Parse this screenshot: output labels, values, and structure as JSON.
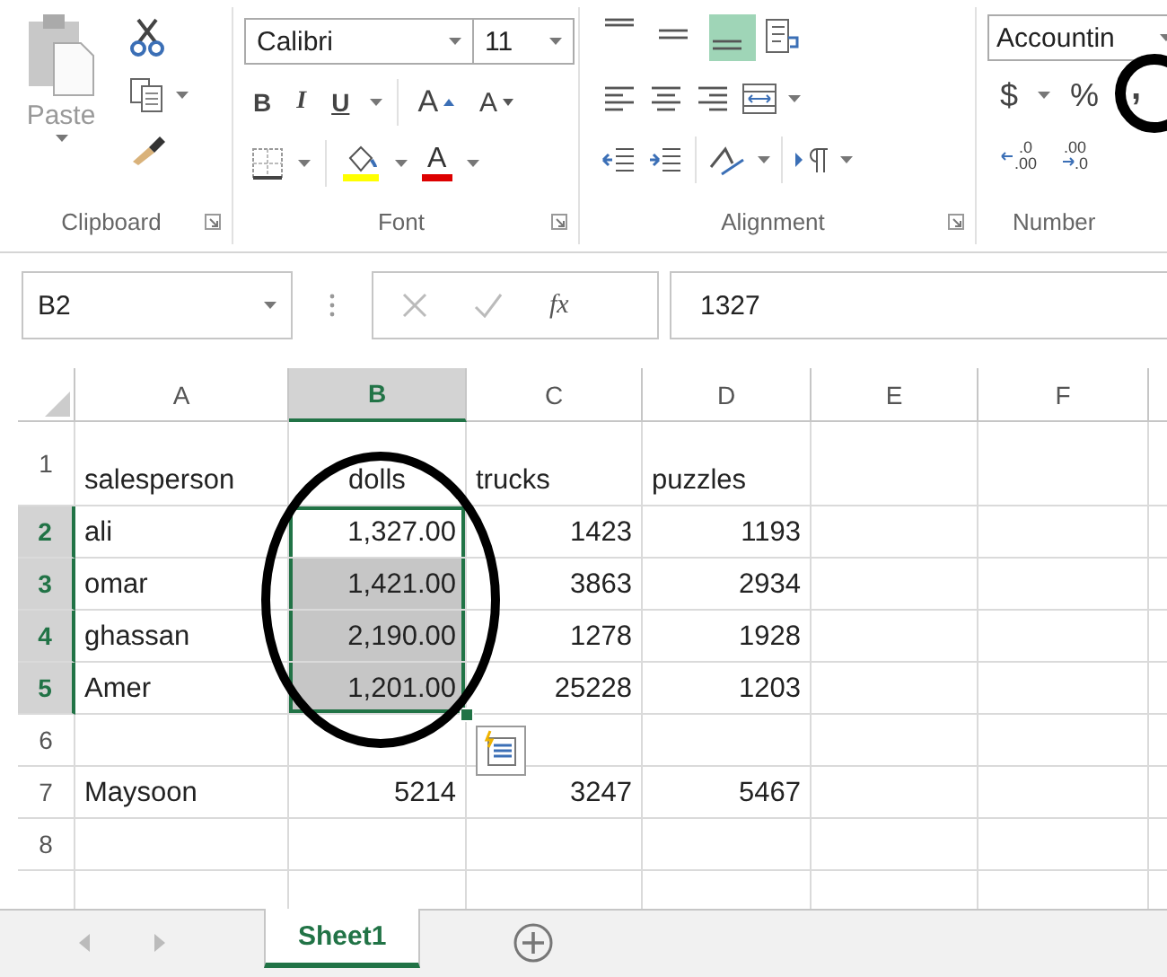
{
  "ribbon": {
    "clipboard": {
      "label": "Clipboard",
      "paste": "Paste"
    },
    "font": {
      "label": "Font",
      "name": "Calibri",
      "size": "11",
      "bold": "B",
      "italic": "I",
      "underline": "U",
      "grow": "A",
      "shrink": "A",
      "font_color": "A"
    },
    "alignment": {
      "label": "Alignment",
      "vertical": [
        {
          "kind": "top",
          "selected": false
        },
        {
          "kind": "middle",
          "selected": false
        },
        {
          "kind": "bottom",
          "selected": true
        }
      ]
    },
    "number": {
      "label": "Number",
      "format": "Accountin",
      "currency": "$",
      "percent": "%",
      "comma": ",",
      "decimals": [
        {
          "kind": "increase",
          "top": ".0",
          "bottom": ".00"
        },
        {
          "kind": "decrease",
          "top": ".00",
          "bottom": ".0"
        }
      ]
    }
  },
  "formula_bar": {
    "name_box": "B2",
    "fx": "fx",
    "value": "1327"
  },
  "columns": [
    {
      "label": "A",
      "selected": false
    },
    {
      "label": "B",
      "selected": true
    },
    {
      "label": "C",
      "selected": false
    },
    {
      "label": "D",
      "selected": false
    },
    {
      "label": "E",
      "selected": false
    },
    {
      "label": "F",
      "selected": false
    }
  ],
  "rows": [
    {
      "label": "1",
      "selected": false,
      "cells": [
        {
          "text": "salesperson",
          "kind": "text",
          "selected": false,
          "active": false
        },
        {
          "text": "dolls",
          "kind": "center",
          "selected": false,
          "active": false
        },
        {
          "text": "trucks",
          "kind": "text",
          "selected": false,
          "active": false
        },
        {
          "text": "puzzles",
          "kind": "text",
          "selected": false,
          "active": false
        },
        {
          "selected": false,
          "active": false
        },
        {
          "selected": false,
          "active": false
        }
      ]
    },
    {
      "label": "2",
      "selected": true,
      "cells": [
        {
          "text": "ali",
          "kind": "text",
          "selected": false,
          "active": false
        },
        {
          "text": "1,327.00",
          "kind": "number",
          "selected": true,
          "active": true
        },
        {
          "text": "1423",
          "kind": "number",
          "selected": false,
          "active": false
        },
        {
          "text": "1193",
          "kind": "number",
          "selected": false,
          "active": false
        },
        {
          "selected": false,
          "active": false
        },
        {
          "selected": false,
          "active": false
        }
      ]
    },
    {
      "label": "3",
      "selected": true,
      "cells": [
        {
          "text": "omar",
          "kind": "text",
          "selected": false,
          "active": false
        },
        {
          "text": "1,421.00",
          "kind": "number",
          "selected": true,
          "active": false
        },
        {
          "text": "3863",
          "kind": "number",
          "selected": false,
          "active": false
        },
        {
          "text": "2934",
          "kind": "number",
          "selected": false,
          "active": false
        },
        {
          "selected": false,
          "active": false
        },
        {
          "selected": false,
          "active": false
        }
      ]
    },
    {
      "label": "4",
      "selected": true,
      "cells": [
        {
          "text": "ghassan",
          "kind": "text",
          "selected": false,
          "active": false
        },
        {
          "text": "2,190.00",
          "kind": "number",
          "selected": true,
          "active": false
        },
        {
          "text": "1278",
          "kind": "number",
          "selected": false,
          "active": false
        },
        {
          "text": "1928",
          "kind": "number",
          "selected": false,
          "active": false
        },
        {
          "selected": false,
          "active": false
        },
        {
          "selected": false,
          "active": false
        }
      ]
    },
    {
      "label": "5",
      "selected": true,
      "cells": [
        {
          "text": "Amer",
          "kind": "text",
          "selected": false,
          "active": false
        },
        {
          "text": "1,201.00",
          "kind": "number",
          "selected": true,
          "active": false
        },
        {
          "text": "25228",
          "kind": "number",
          "selected": false,
          "active": false
        },
        {
          "text": "1203",
          "kind": "number",
          "selected": false,
          "active": false
        },
        {
          "selected": false,
          "active": false
        },
        {
          "selected": false,
          "active": false
        }
      ]
    },
    {
      "label": "6",
      "selected": false,
      "cells": [
        {
          "selected": false,
          "active": false
        },
        {
          "selected": false,
          "active": false
        },
        {
          "selected": false,
          "active": false
        },
        {
          "selected": false,
          "active": false
        },
        {
          "selected": false,
          "active": false
        },
        {
          "selected": false,
          "active": false
        }
      ]
    },
    {
      "label": "7",
      "selected": false,
      "cells": [
        {
          "text": "Maysoon",
          "kind": "text",
          "selected": false,
          "active": false
        },
        {
          "text": "5214",
          "kind": "number",
          "selected": false,
          "active": false
        },
        {
          "text": "3247",
          "kind": "number",
          "selected": false,
          "active": false
        },
        {
          "text": "5467",
          "kind": "number",
          "selected": false,
          "active": false
        },
        {
          "selected": false,
          "active": false
        },
        {
          "selected": false,
          "active": false
        }
      ]
    },
    {
      "label": "8",
      "selected": false,
      "cells": [
        {
          "selected": false,
          "active": false
        },
        {
          "selected": false,
          "active": false
        },
        {
          "selected": false,
          "active": false
        },
        {
          "selected": false,
          "active": false
        },
        {
          "selected": false,
          "active": false
        },
        {
          "selected": false,
          "active": false
        }
      ]
    }
  ],
  "sheet_tabs": [
    {
      "label": "Sheet1",
      "selected": true
    }
  ]
}
